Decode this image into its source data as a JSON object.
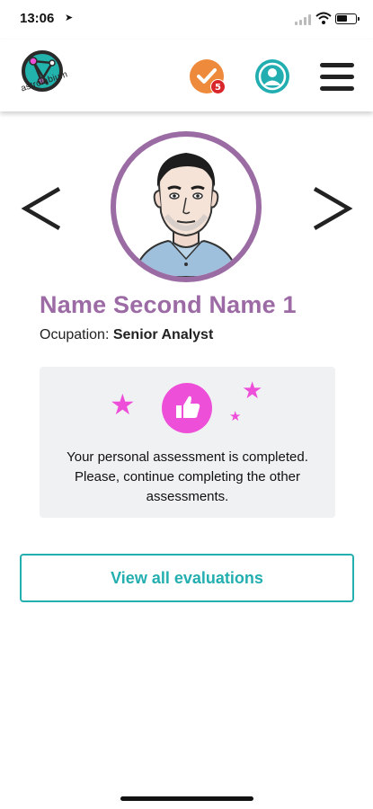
{
  "status_bar": {
    "time": "13:06"
  },
  "header": {
    "logo_text": "astrolabium",
    "tasks_badge_count": "5"
  },
  "profile": {
    "name": "Name Second Name 1",
    "occupation_label": "Ocupation:",
    "occupation_value": "Senior Analyst"
  },
  "assessment": {
    "message": "Your personal assessment is completed. Please, continue completing the other assessments."
  },
  "actions": {
    "view_all_label": "View all evaluations"
  },
  "colors": {
    "accent_teal": "#23aeb0",
    "name_purple": "#9c6aa4",
    "tasks_orange": "#ee8a3c",
    "badge_red": "#d9262a",
    "star_pink": "#ee4fd9"
  },
  "icons": [
    "location-arrow-icon",
    "signal-icon",
    "wifi-icon",
    "battery-icon",
    "logo-icon",
    "check-icon",
    "user-icon",
    "menu-icon",
    "chevron-left-icon",
    "chevron-right-icon",
    "star-icon",
    "thumbs-up-icon"
  ]
}
